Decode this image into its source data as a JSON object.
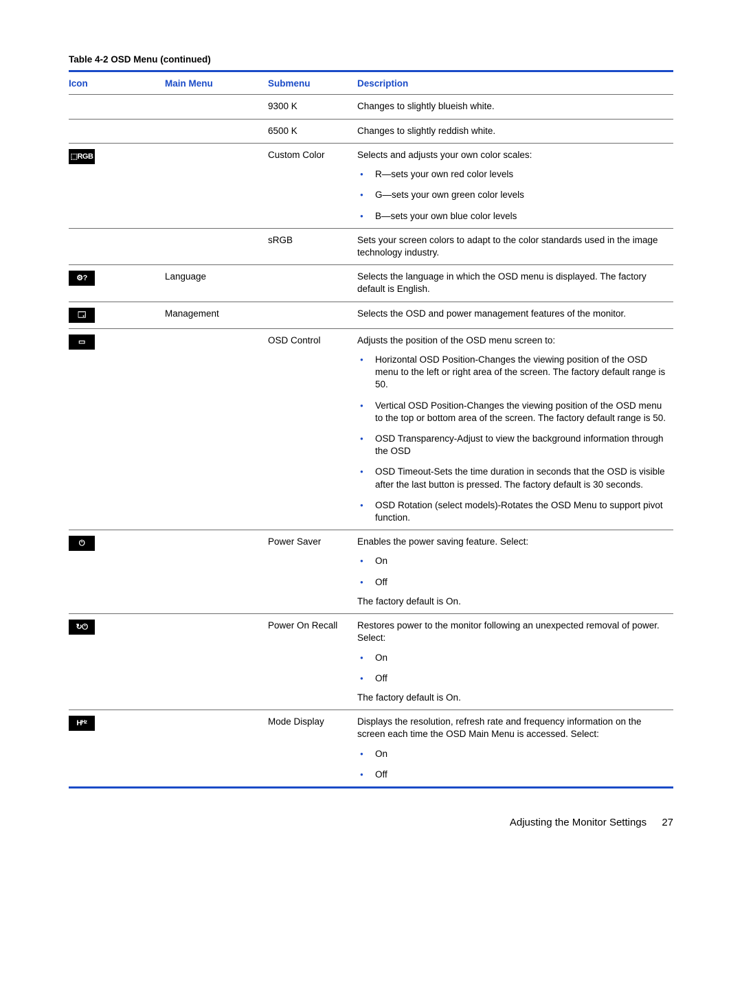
{
  "caption_prefix": "Table 4-2",
  "caption_rest": "  OSD Menu (continued)",
  "headers": {
    "icon": "Icon",
    "main": "Main Menu",
    "sub": "Submenu",
    "desc": "Description"
  },
  "rows": {
    "r1": {
      "sub": "9300 K",
      "desc": "Changes to slightly blueish white."
    },
    "r2": {
      "sub": "6500 K",
      "desc": "Changes to slightly reddish white."
    },
    "r3": {
      "icon": "custom-color-icon",
      "icon_txt": "⬚RGB",
      "sub": "Custom Color",
      "desc": "Selects and adjusts your own color scales:",
      "b1": "R—sets your own red color levels",
      "b2": "G—sets your own green color levels",
      "b3": "B—sets your own blue color levels"
    },
    "r4": {
      "sub": "sRGB",
      "desc": "Sets your screen colors to adapt to the color standards used in the image technology industry."
    },
    "r5": {
      "icon": "language-icon",
      "icon_txt": "⚙?",
      "main": "Language",
      "desc": "Selects the language in which the OSD menu is displayed. The factory default is English."
    },
    "r6": {
      "icon": "management-icon",
      "icon_txt": "🗔",
      "main": "Management",
      "desc": "Selects the OSD and power management features of the monitor."
    },
    "r7": {
      "icon": "osd-control-icon",
      "icon_txt": "▭",
      "sub": "OSD Control",
      "desc": "Adjusts the position of the OSD menu screen to:",
      "b1": "Horizontal OSD Position-Changes the viewing position of the OSD menu to the left or right area of the screen. The factory default range is 50.",
      "b2": "Vertical OSD Position-Changes the viewing position of the OSD menu to the top or bottom area of the screen. The factory default range is 50.",
      "b3": "OSD Transparency-Adjust to view the background information through the OSD",
      "b4": "OSD Timeout-Sets the time duration in seconds that the OSD is visible after the last button is pressed. The factory default is 30 seconds.",
      "b5": "OSD Rotation (select models)-Rotates the OSD Menu to support pivot function."
    },
    "r8": {
      "icon": "power-saver-icon",
      "icon_txt": "⏻",
      "sub": "Power Saver",
      "desc": "Enables the power saving feature. Select:",
      "b1": "On",
      "b2": "Off",
      "tail": "The factory default is On."
    },
    "r9": {
      "icon": "power-on-recall-icon",
      "icon_txt": "↻⏻",
      "sub": "Power On Recall",
      "desc": "Restores power to the monitor following an unexpected removal of power. Select:",
      "b1": "On",
      "b2": "Off",
      "tail": "The factory default is On."
    },
    "r10": {
      "icon": "mode-display-icon",
      "icon_txt": "Hᴴᶻ",
      "sub": "Mode Display",
      "desc": "Displays the resolution, refresh rate and frequency information on the screen each time the OSD Main Menu is accessed. Select:",
      "b1": "On",
      "b2": "Off"
    }
  },
  "footer": {
    "section": "Adjusting the Monitor Settings",
    "page": "27"
  }
}
